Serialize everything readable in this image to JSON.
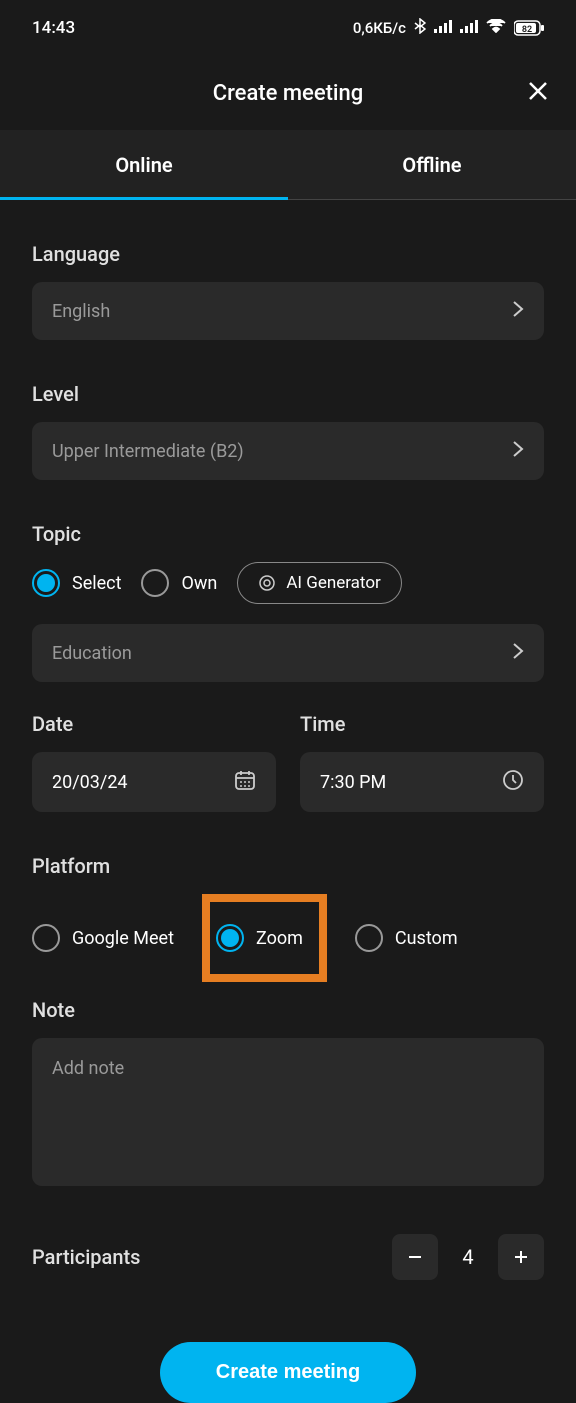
{
  "statusbar": {
    "time": "14:43",
    "network": "0,6КБ/с",
    "battery": "82"
  },
  "header": {
    "title": "Create meeting"
  },
  "tabs": {
    "online": "Online",
    "offline": "Offline"
  },
  "fields": {
    "language": {
      "label": "Language",
      "value": "English"
    },
    "level": {
      "label": "Level",
      "value": "Upper Intermediate (B2)"
    },
    "topic": {
      "label": "Topic",
      "select": "Select",
      "own": "Own",
      "ai": "AI Generator",
      "value": "Education"
    },
    "date": {
      "label": "Date",
      "value": "20/03/24"
    },
    "time": {
      "label": "Time",
      "value": "7:30 PM"
    },
    "platform": {
      "label": "Platform",
      "google": "Google Meet",
      "zoom": "Zoom",
      "custom": "Custom"
    },
    "note": {
      "label": "Note",
      "placeholder": "Add note"
    },
    "participants": {
      "label": "Participants",
      "value": "4"
    }
  },
  "buttons": {
    "create": "Create meeting"
  }
}
